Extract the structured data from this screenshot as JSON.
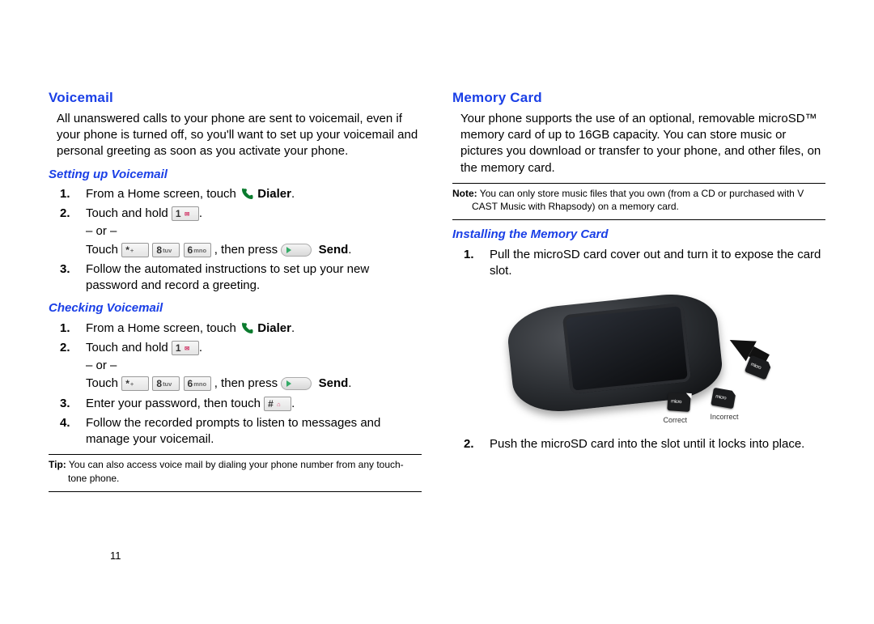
{
  "page_number": "11",
  "left": {
    "heading": "Voicemail",
    "intro": "All unanswered calls to your phone are sent to voicemail, even if your phone is turned off, so you'll want to set up your voicemail and personal greeting as soon as you activate your phone.",
    "setup": {
      "heading": "Setting up Voicemail",
      "s1_a": "From a Home screen, touch ",
      "s1_b": "Dialer",
      "s1_c": ".",
      "s2_a": "Touch and hold ",
      "s2_b": ".",
      "or": "– or –",
      "s2_c": "Touch ",
      "s2_d": ", then press ",
      "s2_e": "Send",
      "s2_f": ".",
      "s3": "Follow the automated instructions to set up your new password and record a greeting."
    },
    "check": {
      "heading": "Checking Voicemail",
      "s1_a": "From a Home screen, touch ",
      "s1_b": "Dialer",
      "s1_c": ".",
      "s2_a": "Touch and hold ",
      "s2_b": ".",
      "or": "– or –",
      "s2_c": "Touch ",
      "s2_d": ", then press ",
      "s2_e": "Send",
      "s2_f": ".",
      "s3_a": "Enter your password, then touch ",
      "s3_b": ".",
      "s4": "Follow the recorded prompts to listen to messages and manage your voicemail."
    },
    "tip_label": "Tip:",
    "tip_text": " You can also access voice mail by dialing your phone number from any touch-tone phone.",
    "keys": {
      "one": "1",
      "star": "*",
      "plus": "+",
      "eight": "8",
      "eight_sub": "tuv",
      "six": "6",
      "six_sub": "mno",
      "hash": "#"
    }
  },
  "right": {
    "heading": "Memory Card",
    "intro": "Your phone supports the use of an optional, removable microSD™ memory card of up to 16GB capacity.  You can store music or pictures you download or transfer to your phone, and other files, on the memory card.",
    "note_label": "Note:",
    "note_text": " You can only store music files that you own (from a CD or purchased with V CAST Music with Rhapsody) on a memory card.",
    "install": {
      "heading": "Installing the Memory Card",
      "s1": "Pull the microSD card cover out and turn it to expose the card slot.",
      "s2": "Push the microSD card into the slot until it locks into place.",
      "correct": "Correct",
      "incorrect": "Incorrect"
    }
  }
}
